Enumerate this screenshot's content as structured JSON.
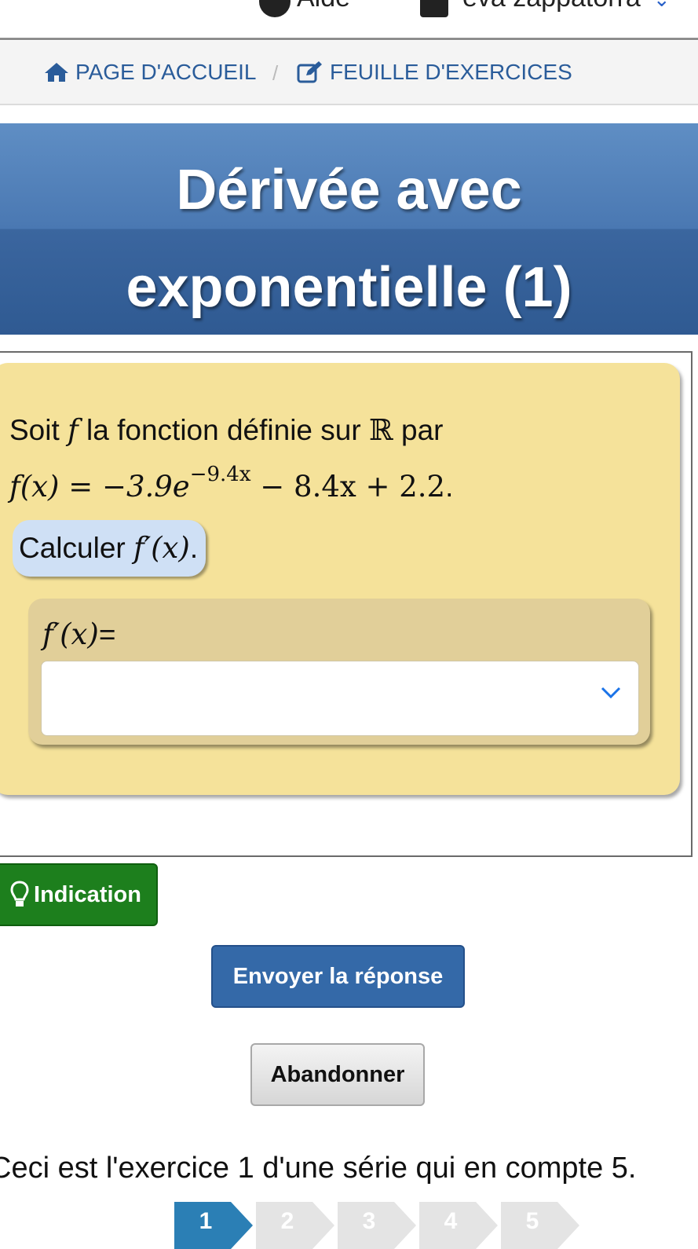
{
  "topbar": {
    "help_label": "Aide",
    "user_label": "eva zappatorra"
  },
  "breadcrumb": {
    "home_label": "PAGE D'ACCUEIL",
    "separator": "/",
    "sheet_label": "FEUILLE D'EXERCICES"
  },
  "exercise": {
    "title": "Dérivée avec exponentielle (1)",
    "statement_intro": "Soit",
    "statement_func": "f",
    "statement_mid": "la fonction définie sur",
    "statement_set": "ℝ",
    "statement_end": "par",
    "formula_lhs": "f(x) = −3.9e",
    "formula_exponent": "−9.4x",
    "formula_rhs": " − 8.4x + 2.2",
    "formula_end": ".",
    "question_prefix": "Calculer",
    "question_math": "f′(x)",
    "question_end": ".",
    "answer_label_math": "f′(x)",
    "answer_label_suffix": "=",
    "answer_value": ""
  },
  "buttons": {
    "hint": "Indication",
    "send": "Envoyer la réponse",
    "quit": "Abandonner"
  },
  "series": {
    "info": "Ceci est l'exercice 1 d'une série qui en compte 5.",
    "pages": [
      "1",
      "2",
      "3",
      "4",
      "5"
    ],
    "current": 1
  },
  "colors": {
    "banner": "#3b669f",
    "statement_bg": "#f5e29a",
    "question_bg": "#cfe0f5",
    "hint_button": "#1d7f1d",
    "send_button": "#3469a8",
    "active_page": "#2b7fb5"
  },
  "icons": {
    "help": "question-circle-icon",
    "user": "user-icon",
    "home": "home-icon",
    "edit": "edit-icon",
    "dropdown": "chevron-down-icon",
    "hint": "lightbulb-icon"
  }
}
